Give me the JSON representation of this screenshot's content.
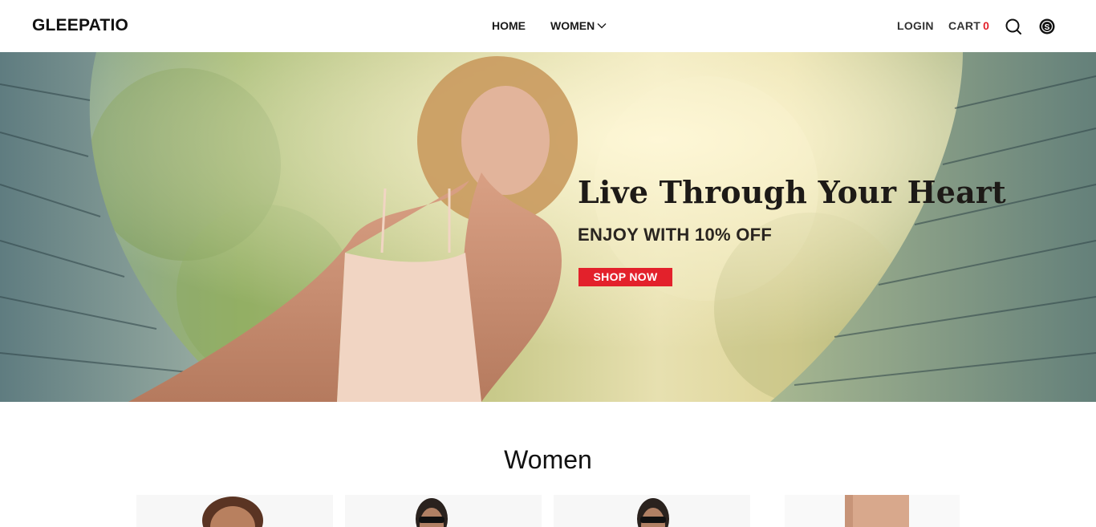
{
  "header": {
    "logo": "GLEEPATIO",
    "nav": [
      {
        "label": "HOME"
      },
      {
        "label": "WOMEN"
      }
    ],
    "login_label": "LOGIN",
    "cart_label": "CART",
    "cart_count": "0",
    "icons": [
      "chevron-down-icon",
      "search-icon",
      "currency-icon"
    ]
  },
  "hero": {
    "title": "Live Through Your Heart",
    "subtitle": "ENJOY WITH 10% OFF",
    "cta_label": "SHOP NOW"
  },
  "section": {
    "title": "Women"
  },
  "colors": {
    "accent": "#e3212b",
    "text": "#111111",
    "background": "#ffffff"
  }
}
